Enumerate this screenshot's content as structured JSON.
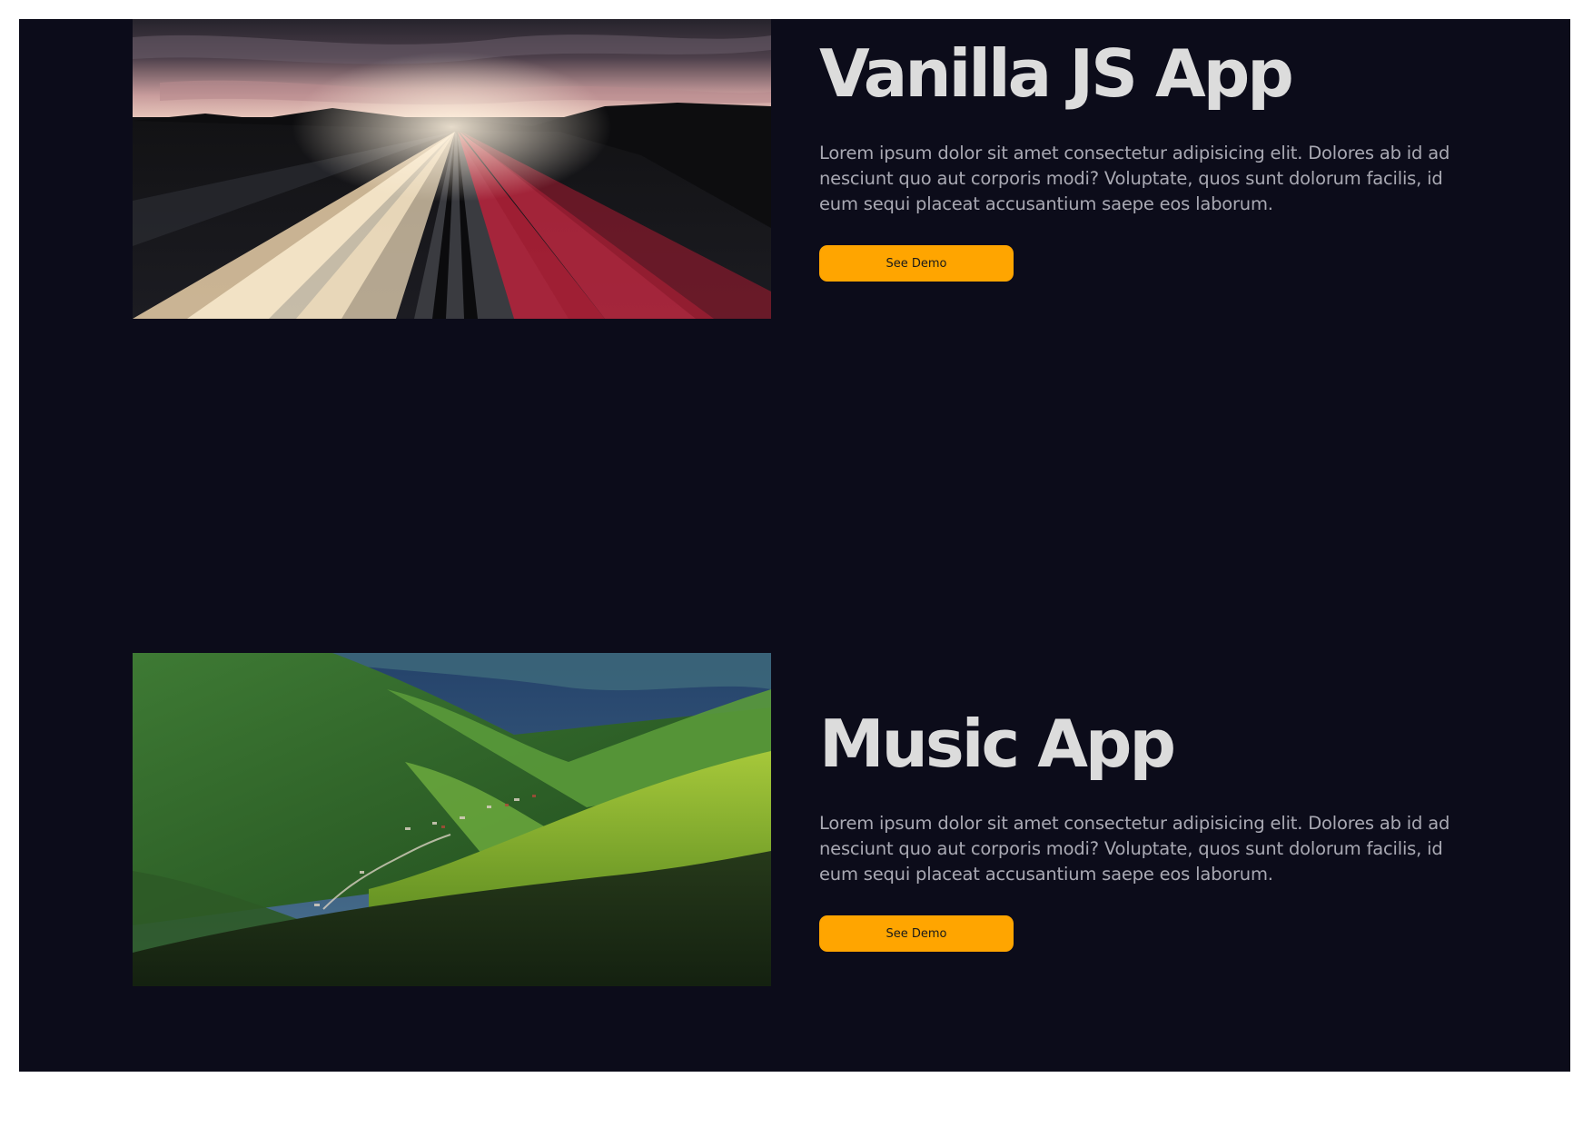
{
  "theme": {
    "background": "#0c0c1a",
    "accent": "#ffa500",
    "title_color": "#dcdcdc",
    "text_color": "#a9a9b3"
  },
  "projects": [
    {
      "title": "Vanilla JS App",
      "description": "Lorem ipsum dolor sit amet consectetur adipisicing elit. Dolores ab id ad nesciunt quo aut corporis modi? Voluptate, quos sunt dolorum facilis, id eum sequi placeat accusantium saepe eos laborum.",
      "button_label": "See Demo",
      "image": "highway-light-trails-photo"
    },
    {
      "title": "Music App",
      "description": "Lorem ipsum dolor sit amet consectetur adipisicing elit. Dolores ab id ad nesciunt quo aut corporis modi? Voluptate, quos sunt dolorum facilis, id eum sequi placeat accusantium saepe eos laborum.",
      "button_label": "See Demo",
      "image": "green-valley-photo"
    }
  ]
}
